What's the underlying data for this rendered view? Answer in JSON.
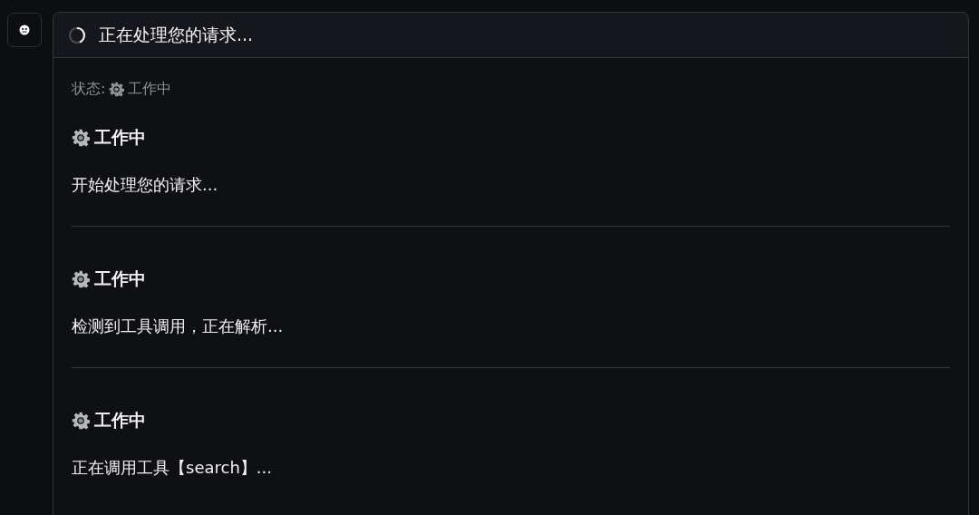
{
  "header": {
    "title": "正在处理您的请求..."
  },
  "status": {
    "label": "状态:",
    "value": "工作中"
  },
  "steps": [
    {
      "title": "工作中",
      "message": "开始处理您的请求..."
    },
    {
      "title": "工作中",
      "message": "检测到工具调用，正在解析..."
    },
    {
      "title": "工作中",
      "message": "正在调用工具【search】..."
    }
  ]
}
